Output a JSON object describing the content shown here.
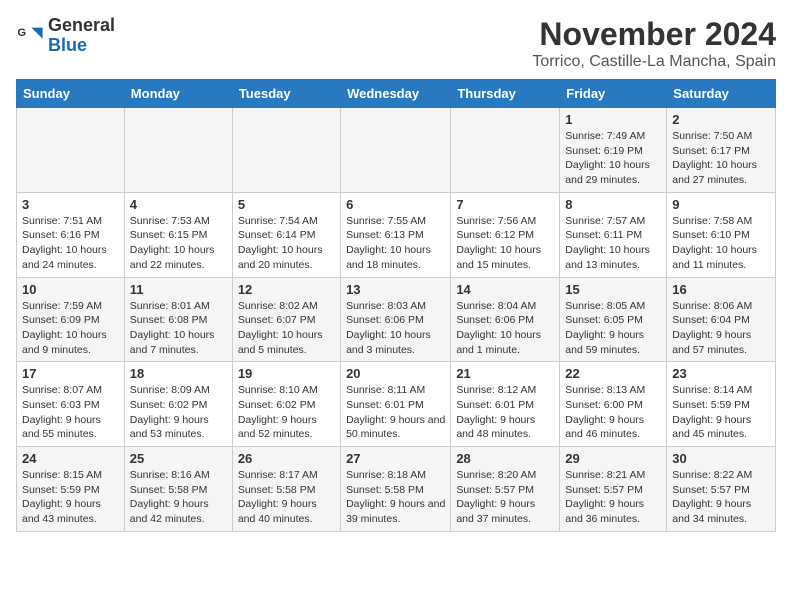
{
  "logo": {
    "general": "General",
    "blue": "Blue"
  },
  "title": "November 2024",
  "location": "Torrico, Castille-La Mancha, Spain",
  "weekdays": [
    "Sunday",
    "Monday",
    "Tuesday",
    "Wednesday",
    "Thursday",
    "Friday",
    "Saturday"
  ],
  "weeks": [
    [
      {
        "day": "",
        "info": ""
      },
      {
        "day": "",
        "info": ""
      },
      {
        "day": "",
        "info": ""
      },
      {
        "day": "",
        "info": ""
      },
      {
        "day": "",
        "info": ""
      },
      {
        "day": "1",
        "info": "Sunrise: 7:49 AM\nSunset: 6:19 PM\nDaylight: 10 hours and 29 minutes."
      },
      {
        "day": "2",
        "info": "Sunrise: 7:50 AM\nSunset: 6:17 PM\nDaylight: 10 hours and 27 minutes."
      }
    ],
    [
      {
        "day": "3",
        "info": "Sunrise: 7:51 AM\nSunset: 6:16 PM\nDaylight: 10 hours and 24 minutes."
      },
      {
        "day": "4",
        "info": "Sunrise: 7:53 AM\nSunset: 6:15 PM\nDaylight: 10 hours and 22 minutes."
      },
      {
        "day": "5",
        "info": "Sunrise: 7:54 AM\nSunset: 6:14 PM\nDaylight: 10 hours and 20 minutes."
      },
      {
        "day": "6",
        "info": "Sunrise: 7:55 AM\nSunset: 6:13 PM\nDaylight: 10 hours and 18 minutes."
      },
      {
        "day": "7",
        "info": "Sunrise: 7:56 AM\nSunset: 6:12 PM\nDaylight: 10 hours and 15 minutes."
      },
      {
        "day": "8",
        "info": "Sunrise: 7:57 AM\nSunset: 6:11 PM\nDaylight: 10 hours and 13 minutes."
      },
      {
        "day": "9",
        "info": "Sunrise: 7:58 AM\nSunset: 6:10 PM\nDaylight: 10 hours and 11 minutes."
      }
    ],
    [
      {
        "day": "10",
        "info": "Sunrise: 7:59 AM\nSunset: 6:09 PM\nDaylight: 10 hours and 9 minutes."
      },
      {
        "day": "11",
        "info": "Sunrise: 8:01 AM\nSunset: 6:08 PM\nDaylight: 10 hours and 7 minutes."
      },
      {
        "day": "12",
        "info": "Sunrise: 8:02 AM\nSunset: 6:07 PM\nDaylight: 10 hours and 5 minutes."
      },
      {
        "day": "13",
        "info": "Sunrise: 8:03 AM\nSunset: 6:06 PM\nDaylight: 10 hours and 3 minutes."
      },
      {
        "day": "14",
        "info": "Sunrise: 8:04 AM\nSunset: 6:06 PM\nDaylight: 10 hours and 1 minute."
      },
      {
        "day": "15",
        "info": "Sunrise: 8:05 AM\nSunset: 6:05 PM\nDaylight: 9 hours and 59 minutes."
      },
      {
        "day": "16",
        "info": "Sunrise: 8:06 AM\nSunset: 6:04 PM\nDaylight: 9 hours and 57 minutes."
      }
    ],
    [
      {
        "day": "17",
        "info": "Sunrise: 8:07 AM\nSunset: 6:03 PM\nDaylight: 9 hours and 55 minutes."
      },
      {
        "day": "18",
        "info": "Sunrise: 8:09 AM\nSunset: 6:02 PM\nDaylight: 9 hours and 53 minutes."
      },
      {
        "day": "19",
        "info": "Sunrise: 8:10 AM\nSunset: 6:02 PM\nDaylight: 9 hours and 52 minutes."
      },
      {
        "day": "20",
        "info": "Sunrise: 8:11 AM\nSunset: 6:01 PM\nDaylight: 9 hours and 50 minutes."
      },
      {
        "day": "21",
        "info": "Sunrise: 8:12 AM\nSunset: 6:01 PM\nDaylight: 9 hours and 48 minutes."
      },
      {
        "day": "22",
        "info": "Sunrise: 8:13 AM\nSunset: 6:00 PM\nDaylight: 9 hours and 46 minutes."
      },
      {
        "day": "23",
        "info": "Sunrise: 8:14 AM\nSunset: 5:59 PM\nDaylight: 9 hours and 45 minutes."
      }
    ],
    [
      {
        "day": "24",
        "info": "Sunrise: 8:15 AM\nSunset: 5:59 PM\nDaylight: 9 hours and 43 minutes."
      },
      {
        "day": "25",
        "info": "Sunrise: 8:16 AM\nSunset: 5:58 PM\nDaylight: 9 hours and 42 minutes."
      },
      {
        "day": "26",
        "info": "Sunrise: 8:17 AM\nSunset: 5:58 PM\nDaylight: 9 hours and 40 minutes."
      },
      {
        "day": "27",
        "info": "Sunrise: 8:18 AM\nSunset: 5:58 PM\nDaylight: 9 hours and 39 minutes."
      },
      {
        "day": "28",
        "info": "Sunrise: 8:20 AM\nSunset: 5:57 PM\nDaylight: 9 hours and 37 minutes."
      },
      {
        "day": "29",
        "info": "Sunrise: 8:21 AM\nSunset: 5:57 PM\nDaylight: 9 hours and 36 minutes."
      },
      {
        "day": "30",
        "info": "Sunrise: 8:22 AM\nSunset: 5:57 PM\nDaylight: 9 hours and 34 minutes."
      }
    ]
  ]
}
